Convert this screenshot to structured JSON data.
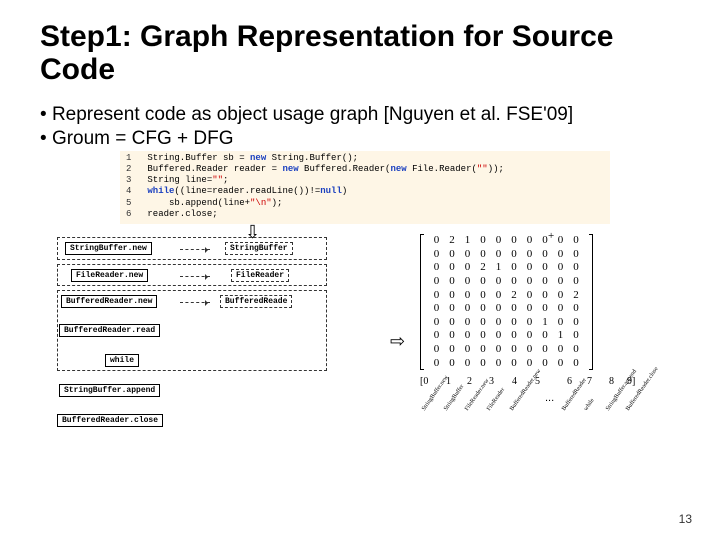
{
  "title": "Step1: Graph Representation for Source Code",
  "bullets": [
    "Represent code as object usage graph [Nguyen et al. FSE'09]",
    "Groum = CFG + DFG"
  ],
  "code": {
    "lines": [
      {
        "n": "1",
        "raw": "String.Buffer sb = new String.Buffer();"
      },
      {
        "n": "2",
        "raw": "Buffered.Reader reader = new Buffered.Reader(new File.Reader(\"\"));"
      },
      {
        "n": "3",
        "raw": "String line=\"\";"
      },
      {
        "n": "4",
        "raw": "while((line=reader.readLine())!=null)"
      },
      {
        "n": "5",
        "raw": "    sb.append(line+\"\\n\");"
      },
      {
        "n": "6",
        "raw": "reader.close;"
      }
    ]
  },
  "nodes": {
    "n1": "StringBuffer.new",
    "t1": "StringBuffer",
    "n2": "FileReader.new",
    "t2": "FileReader",
    "n3": "BufferedReader.new",
    "t3": "BufferedReade",
    "n4": "BufferedReader.read",
    "n5": "while",
    "n6": "StringBuffer.append",
    "n7": "BufferedReader.close"
  },
  "matrix": [
    [
      0,
      2,
      1,
      0,
      0,
      0,
      0,
      0,
      0,
      0
    ],
    [
      0,
      0,
      0,
      0,
      0,
      0,
      0,
      0,
      0,
      0
    ],
    [
      0,
      0,
      0,
      2,
      1,
      0,
      0,
      0,
      0,
      0
    ],
    [
      0,
      0,
      0,
      0,
      0,
      0,
      0,
      0,
      0,
      0
    ],
    [
      0,
      0,
      0,
      0,
      0,
      2,
      0,
      0,
      0,
      2
    ],
    [
      0,
      0,
      0,
      0,
      0,
      0,
      0,
      0,
      0,
      0
    ],
    [
      0,
      0,
      0,
      0,
      0,
      0,
      0,
      1,
      0,
      0
    ],
    [
      0,
      0,
      0,
      0,
      0,
      0,
      0,
      0,
      1,
      0
    ],
    [
      0,
      0,
      0,
      0,
      0,
      0,
      0,
      0,
      0,
      0
    ],
    [
      0,
      0,
      0,
      0,
      0,
      0,
      0,
      0,
      0,
      0
    ]
  ],
  "plus": "+",
  "labels_idx": [
    "[0",
    "1",
    "2",
    "3",
    "4",
    "5",
    "6",
    "7",
    "8",
    "9]"
  ],
  "labels_rot": [
    "StringBuffer.new",
    "StringBuffer",
    "FileReader.new",
    "FileReader",
    "BufferedReader.new",
    "BufferedReader",
    "while",
    "StringBuffer.append",
    "BufferedReader.close"
  ],
  "dots": "...",
  "arrows": {
    "down": "⇩",
    "right": "⇨"
  },
  "page": "13"
}
